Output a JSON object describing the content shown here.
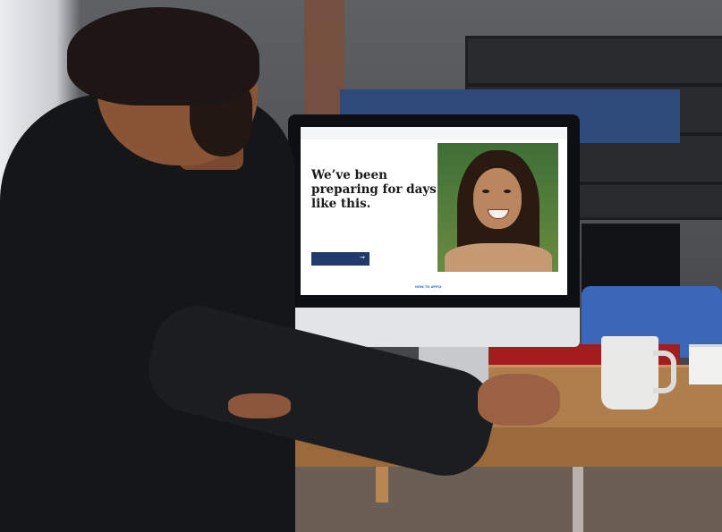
{
  "screen_page": {
    "nav": {
      "left_text": "",
      "middle_text": "",
      "right_text": ""
    },
    "hero": {
      "heading": "We’ve been preparing for days like this.",
      "body": "",
      "cta_label": "",
      "cta_arrow": "→",
      "link_text": "HOW TO APPLY"
    }
  },
  "colors": {
    "cta_background": "#1f3a6b",
    "link": "#2a6fbf",
    "desk": "#b07d4c",
    "sofa": "#3a67b8"
  }
}
